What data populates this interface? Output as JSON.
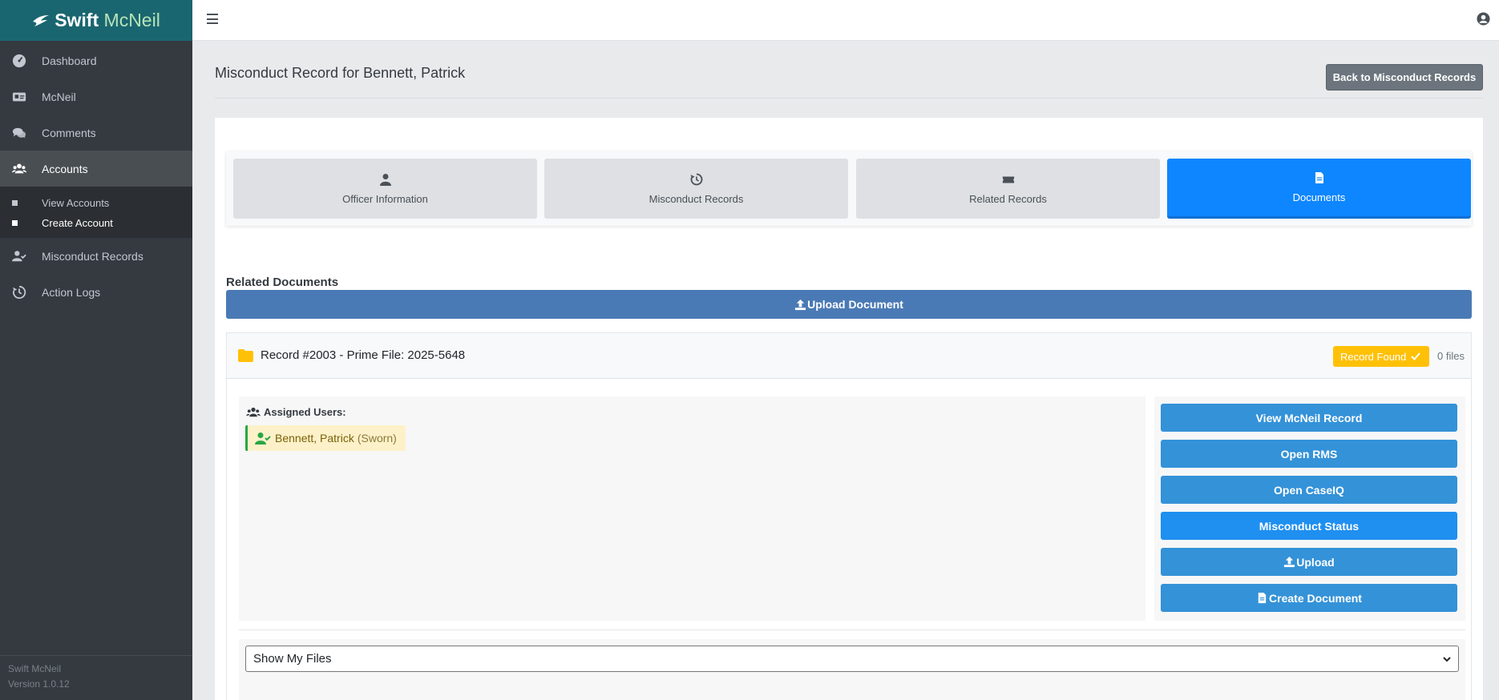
{
  "brand": {
    "name_bold": "Swift",
    "name_light": "McNeil"
  },
  "sidebar": {
    "items": [
      {
        "label": "Dashboard",
        "icon": "dashboard-icon"
      },
      {
        "label": "McNeil",
        "icon": "id-card-icon"
      },
      {
        "label": "Comments",
        "icon": "comments-icon"
      },
      {
        "label": "Accounts",
        "icon": "users-icon",
        "active": true
      },
      {
        "label": "Misconduct Records",
        "icon": "user-check-icon"
      },
      {
        "label": "Action Logs",
        "icon": "history-icon"
      }
    ],
    "subitems": [
      {
        "label": "View Accounts"
      },
      {
        "label": "Create Account",
        "current": true
      }
    ],
    "footer": {
      "app": "Swift McNeil",
      "version": "Version 1.0.12"
    }
  },
  "header": {
    "menu_icon": "hamburger-icon",
    "user_icon": "user-circle-icon"
  },
  "page": {
    "title": "Misconduct Record for Bennett, Patrick",
    "back_label": "Back to Misconduct Records"
  },
  "tabs": [
    {
      "label": "Officer Information",
      "icon": "user-icon"
    },
    {
      "label": "Misconduct Records",
      "icon": "history-icon"
    },
    {
      "label": "Related Records",
      "icon": "ticket-icon"
    },
    {
      "label": "Documents",
      "icon": "file-icon",
      "active": true
    }
  ],
  "documents": {
    "section_label": "Related Documents",
    "upload_label": "Upload Document"
  },
  "record": {
    "title": "Record #2003 - Prime File: 2025-5648",
    "badge": "Record Found",
    "files": "0 files",
    "assigned_label": "Assigned Users:",
    "users": [
      {
        "name": "Bennett, Patrick",
        "role": "(Sworn)"
      }
    ],
    "actions": {
      "view": "View McNeil Record",
      "rms": "Open RMS",
      "caseiq": "Open CaseIQ",
      "status": "Misconduct Status",
      "upload": "Upload",
      "create": "Create Document"
    },
    "filter_selected": "Show My Files"
  },
  "colors": {
    "brand": "#1a6670",
    "sidebar": "#343a40",
    "active_tab": "#0d86ff",
    "upload_bar": "#4a7ab5",
    "action_button": "#3492d8",
    "badge": "#ffc107"
  }
}
